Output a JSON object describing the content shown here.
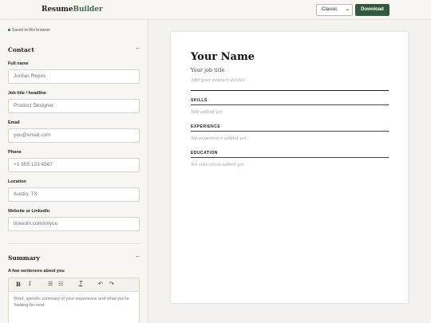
{
  "app": {
    "name_part1": "Resume",
    "name_part2": "Builder"
  },
  "header": {
    "template_value": "Classic",
    "download_label": "Download"
  },
  "form": {
    "saved_status": "Saved to this browser",
    "contact": {
      "title": "Contact",
      "fields": [
        {
          "label": "Full name",
          "placeholder": "Jordan Reyes"
        },
        {
          "label": "Job title / headline",
          "placeholder": "Product Designer"
        },
        {
          "label": "Email",
          "placeholder": "you@email.com"
        },
        {
          "label": "Phone",
          "placeholder": "+1 555 123 4567"
        },
        {
          "label": "Location",
          "placeholder": "Austin, TX"
        },
        {
          "label": "Website or LinkedIn",
          "placeholder": "linkedin.com/in/you"
        }
      ]
    },
    "summary": {
      "title": "Summary",
      "label": "A few sentences about you",
      "placeholder": "Brief, specific summary of your experience and what you're looking for next."
    },
    "collapse_symbol": "–"
  },
  "preview": {
    "name": "Your Name",
    "job_title": "Your job title",
    "contact_hint": "Add your contact details",
    "sections": [
      {
        "heading": "SKILLS",
        "empty": "Not added yet"
      },
      {
        "heading": "EXPERIENCE",
        "empty": "No experience added yet"
      },
      {
        "heading": "EDUCATION",
        "empty": "No education added yet"
      }
    ]
  },
  "icons": [
    "bold-icon",
    "italic-icon",
    "bullet-list-icon",
    "numbered-list-icon",
    "clear-format-icon",
    "undo-icon",
    "redo-icon"
  ],
  "colors": {
    "accent": "#2f5a3c",
    "brand_green": "#3e6b4c"
  }
}
